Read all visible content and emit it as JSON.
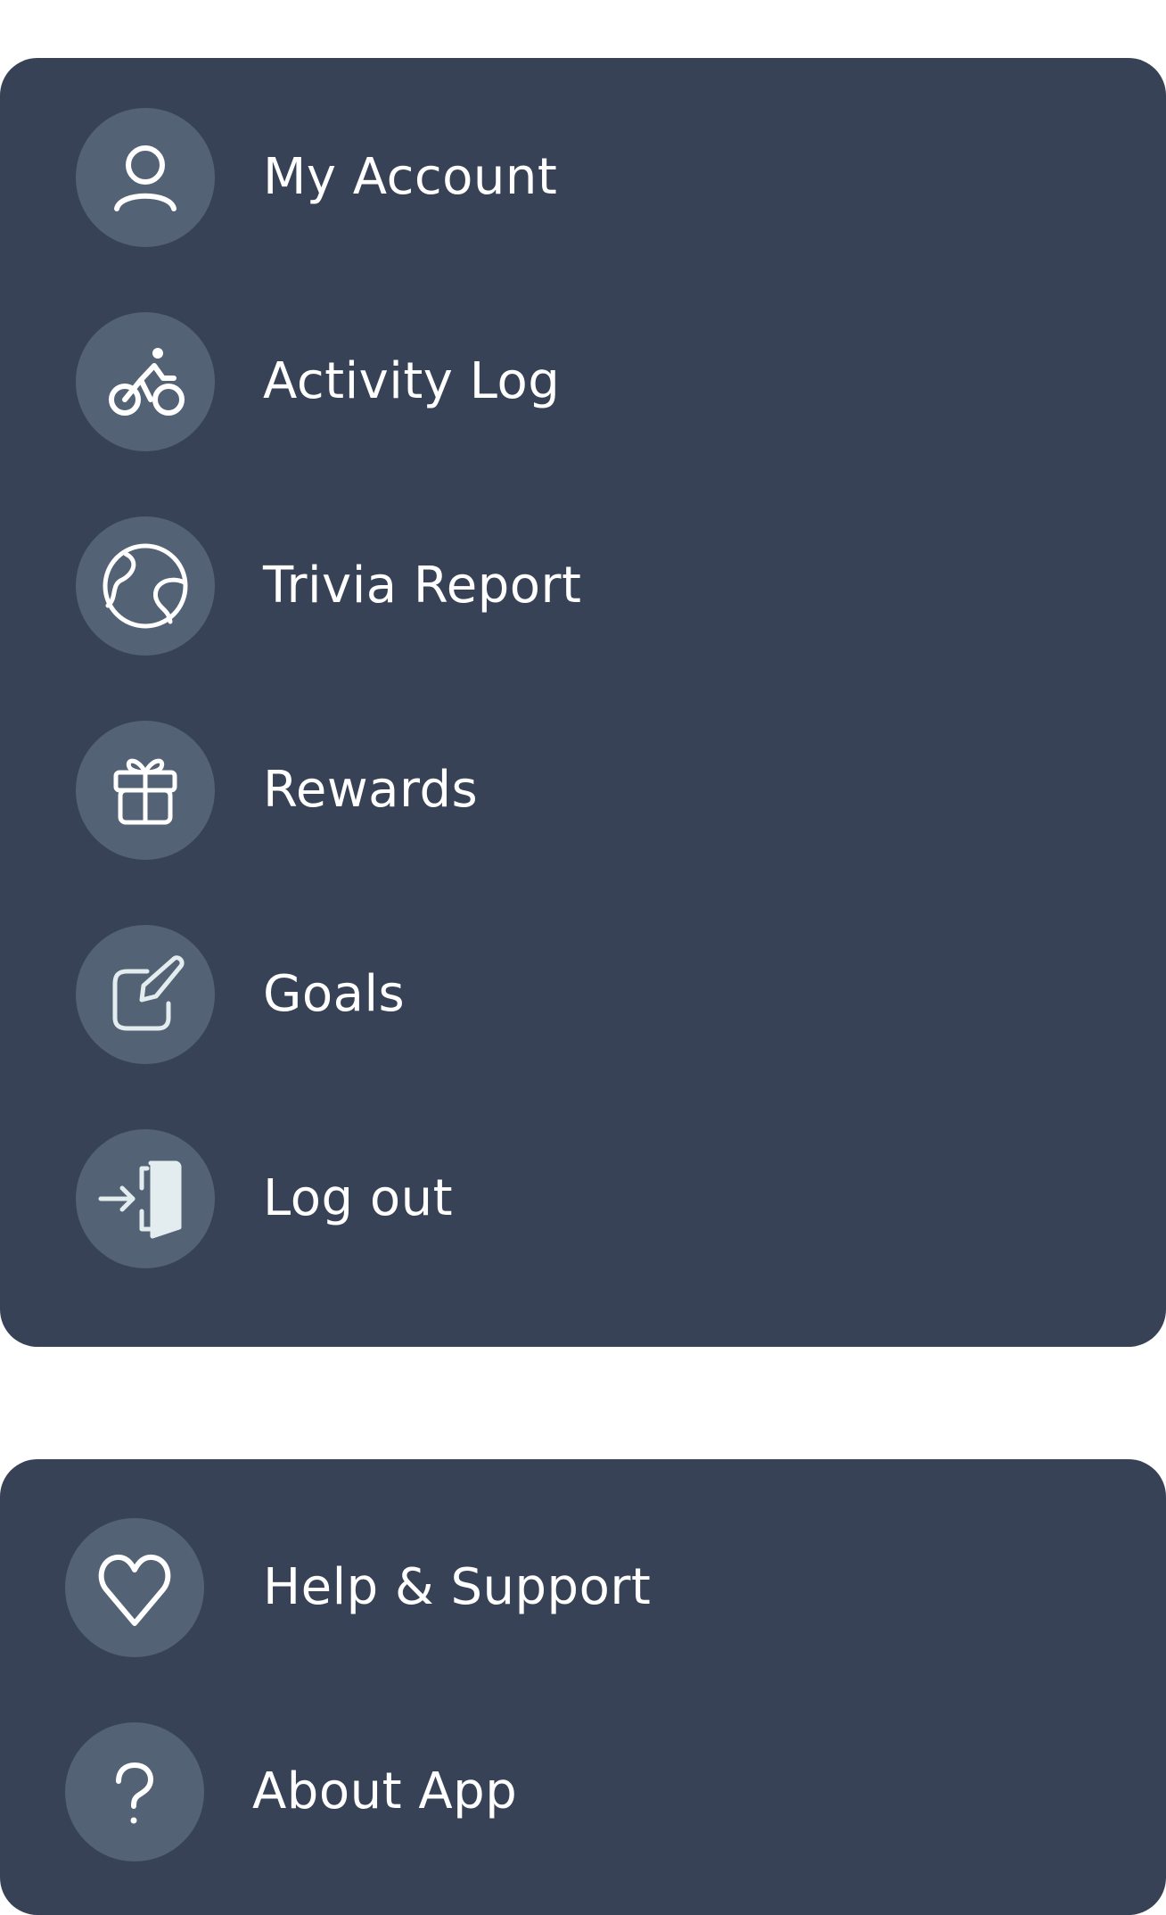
{
  "colors": {
    "panel_bg": "#384256",
    "circle_bg": "#536274",
    "text": "#ffffff",
    "page_bg": "#ffffff"
  },
  "main_menu": {
    "items": [
      {
        "label": "My Account",
        "icon": "user-icon"
      },
      {
        "label": "Activity Log",
        "icon": "cyclist-icon"
      },
      {
        "label": "Trivia Report",
        "icon": "globe-icon"
      },
      {
        "label": "Rewards",
        "icon": "gift-icon"
      },
      {
        "label": "Goals",
        "icon": "edit-icon"
      },
      {
        "label": "Log out",
        "icon": "logout-door-icon"
      }
    ]
  },
  "secondary_menu": {
    "items": [
      {
        "label": "Help & Support",
        "icon": "heart-icon"
      },
      {
        "label": "About App",
        "icon": "question-icon"
      }
    ]
  }
}
